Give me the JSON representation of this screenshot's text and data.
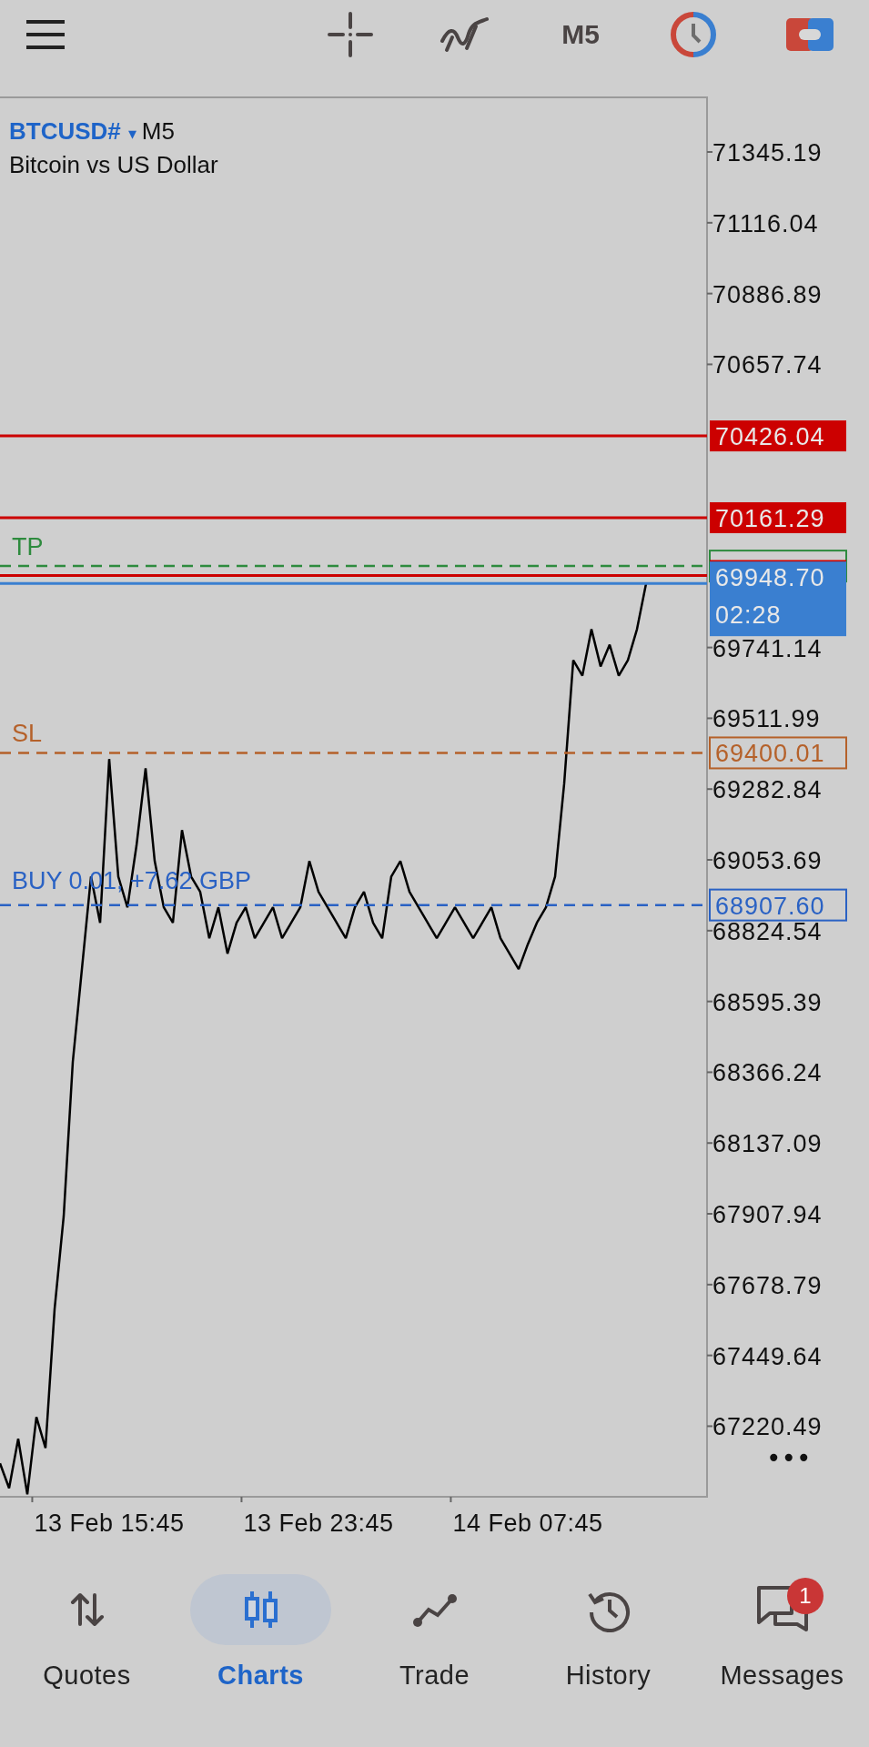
{
  "top_bar": {
    "timeframe": "M5"
  },
  "chart": {
    "symbol": "BTCUSD#",
    "dropdown": "▾",
    "timeframe": "M5",
    "description": "Bitcoin vs US Dollar",
    "more": "•••",
    "chart_data": {
      "type": "line",
      "ylim": [
        66992,
        71522
      ],
      "yticks": [
        71345.19,
        71116.04,
        70886.89,
        70657.74,
        69741.14,
        69511.99,
        69282.84,
        69053.69,
        68824.54,
        68595.39,
        68366.24,
        68137.09,
        67907.94,
        67678.79,
        67449.64,
        67220.49
      ],
      "categories": [
        null,
        null,
        null,
        null,
        null,
        null,
        null,
        null,
        null,
        null,
        null,
        null,
        "13 Feb 15:45",
        null,
        null,
        null,
        null,
        null,
        null,
        null,
        null,
        null,
        null,
        null,
        null,
        null,
        null,
        null,
        null,
        null,
        null,
        null,
        null,
        null,
        null,
        "13 Feb 23:45",
        null,
        null,
        null,
        null,
        null,
        null,
        null,
        null,
        null,
        null,
        null,
        null,
        null,
        null,
        null,
        null,
        null,
        null,
        null,
        null,
        null,
        null,
        "14 Feb 07:45",
        null,
        null,
        null,
        null,
        null,
        null,
        null,
        null,
        null,
        null,
        null,
        null,
        null
      ],
      "series": [
        {
          "color": "#000000",
          "values": [
            67100,
            67020,
            67180,
            67000,
            67250,
            67150,
            67600,
            67900,
            68400,
            68700,
            69000,
            68850,
            69380,
            69000,
            68900,
            69100,
            69350,
            69050,
            68900,
            68850,
            69150,
            69000,
            68950,
            68800,
            68900,
            68750,
            68850,
            68900,
            68800,
            68850,
            68900,
            68800,
            68850,
            68900,
            69050,
            68950,
            68900,
            68850,
            68800,
            68900,
            68950,
            68850,
            68800,
            69000,
            69050,
            68950,
            68900,
            68850,
            68800,
            68850,
            68900,
            68850,
            68800,
            68850,
            68900,
            68800,
            68750,
            68700,
            68780,
            68850,
            68900,
            69000,
            69300,
            69700,
            69650,
            69800,
            69680,
            69750,
            69650,
            69700,
            69800,
            69948
          ]
        }
      ],
      "ref_lines": [
        {
          "axis": "y",
          "value": 70426.04,
          "label": "70426.04"
        },
        {
          "axis": "y",
          "value": 70161.29,
          "label": "70161.29"
        },
        {
          "axis": "y",
          "value": 70004.85,
          "label": "TP"
        },
        {
          "axis": "y",
          "value": 69974.2
        },
        {
          "axis": "y",
          "value": 69948.7,
          "label": "69948.70"
        },
        {
          "axis": "y",
          "value": 69400.01,
          "label": "SL"
        },
        {
          "axis": "y",
          "value": 68907.6,
          "label": "BUY 0.01, +7.62 GBP"
        }
      ]
    },
    "trade_levels": [
      {
        "kind": "alert"
      },
      {
        "kind": "alert"
      },
      {
        "kind": "tp"
      },
      {
        "kind": "ask"
      },
      {
        "kind": "bid",
        "countdown": "02:28"
      },
      {
        "kind": "sl",
        "tag": "69400.01"
      },
      {
        "kind": "position",
        "tag": "68907.60"
      }
    ]
  },
  "nav": [
    {
      "label": "Quotes",
      "selected": false
    },
    {
      "label": "Charts",
      "selected": true
    },
    {
      "label": "Trade",
      "selected": false
    },
    {
      "label": "History",
      "selected": false
    },
    {
      "label": "Messages",
      "selected": false,
      "badge": "1"
    }
  ]
}
